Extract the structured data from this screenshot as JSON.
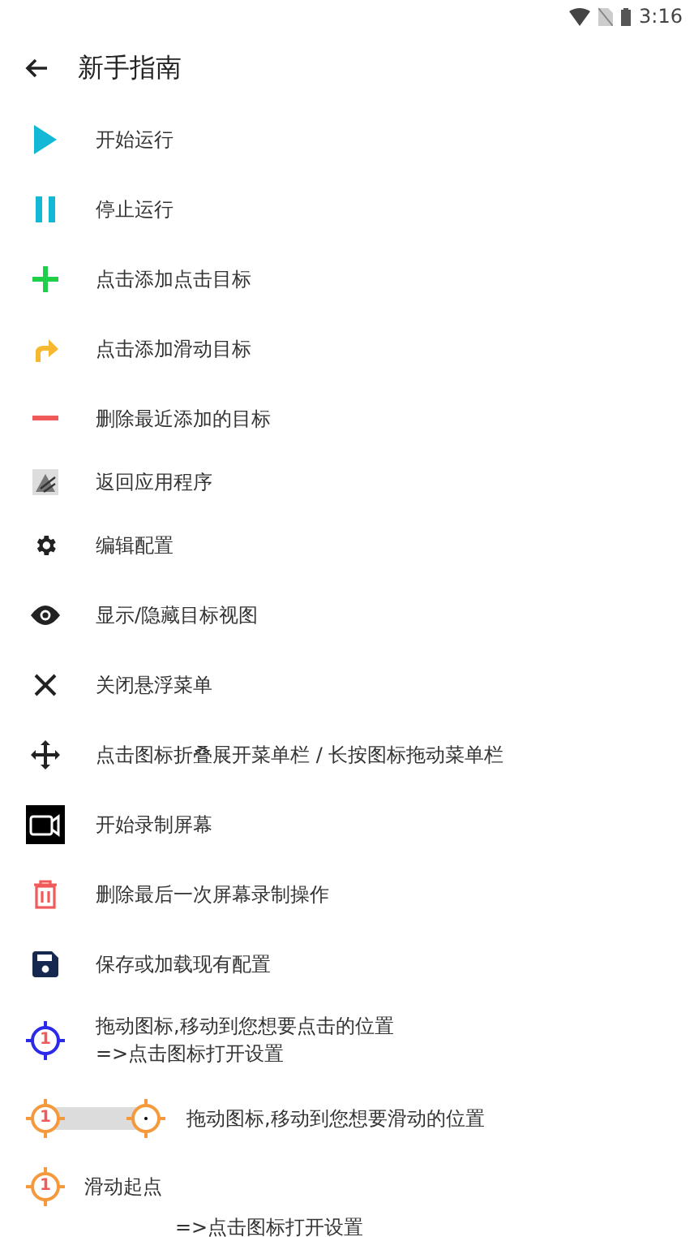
{
  "status_bar": {
    "time": "3:16"
  },
  "header": {
    "title": "新手指南"
  },
  "items": [
    {
      "kind": "icon",
      "label": "开始运行"
    },
    {
      "kind": "icon",
      "label": "停止运行"
    },
    {
      "kind": "icon",
      "label": "点击添加点击目标"
    },
    {
      "kind": "icon",
      "label": "点击添加滑动目标"
    },
    {
      "kind": "icon",
      "label": "删除最近添加的目标"
    },
    {
      "kind": "icon",
      "label": "返回应用程序"
    },
    {
      "kind": "icon",
      "label": "编辑配置"
    },
    {
      "kind": "icon",
      "label": "显示/隐藏目标视图"
    },
    {
      "kind": "icon",
      "label": "关闭悬浮菜单"
    },
    {
      "kind": "icon",
      "label": "点击图标折叠展开菜单栏 / 长按图标拖动菜单栏"
    },
    {
      "kind": "icon",
      "label": "开始录制屏幕"
    },
    {
      "kind": "icon",
      "label": "删除最后一次屏幕录制操作"
    },
    {
      "kind": "icon",
      "label": "保存或加载现有配置"
    }
  ],
  "targets": [
    {
      "kind": "click",
      "badge": "1",
      "lines": [
        "拖动图标,移动到您想要点击的位置",
        "=>点击图标打开设置"
      ]
    },
    {
      "kind": "swipe",
      "badge": "1",
      "lines": [
        "拖动图标,移动到您想要滑动的位置"
      ]
    },
    {
      "kind": "start",
      "badge": "1",
      "lines": [
        "滑动起点",
        "=>点击图标打开设置"
      ]
    }
  ]
}
